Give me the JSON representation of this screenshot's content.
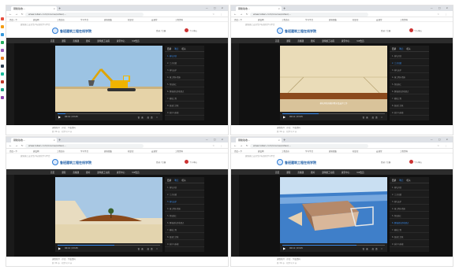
{
  "browser": {
    "tab_title": "钢筋验收…",
    "tab_close": "×",
    "new_tab": "+",
    "window_controls": "— □ ×",
    "nav_buttons": "← → ↻ ⌂",
    "url": "www.luban.com/course/video/…",
    "extensions": "☆ ⋮",
    "bookmarks": [
      "百度一下",
      "建设网",
      "工程造价",
      "学习平台",
      "建筑图集",
      "知识库",
      "云课堂",
      "工程资料"
    ]
  },
  "site": {
    "notice": "建筑施工安全生产标准化学习平台",
    "name": "鲁班建筑工程在线学院",
    "login": "登录 / 注册",
    "user": "个人中心",
    "nav": [
      "首页",
      "课程",
      "直播课",
      "题库",
      "建筑施工动画",
      "资讯中心",
      "VIP会员"
    ]
  },
  "video": {
    "play": "▶",
    "time": "00:12 / 03:45",
    "controls": "倍速 高清 ⛶",
    "caption": "基坑开挖前做好降水及支护工作"
  },
  "playlist": {
    "tabs": [
      "目录",
      "笔记",
      "相关"
    ],
    "items": [
      "1. 基坑开挖",
      "2. 土方回填",
      "3. 基坑支护",
      "4. 施工降水措施",
      "5. 垫层施工",
      "6. 钢筋绑扎验收要点",
      "7. 模板工程",
      "8. 混凝土浇筑",
      "9. 养护与拆模"
    ]
  },
  "footer": {
    "line1": "课程简介 · 评论 · 下载资料",
    "line2": "共 36 节 · 已学习 2 节"
  },
  "app_colors": [
    "#e74c3c",
    "#f39c12",
    "#3498db",
    "#27ae60",
    "#9b59b6",
    "#e67e22",
    "#2c3e50",
    "#1abc9c",
    "#c0392b",
    "#16a085",
    "#8e44ad"
  ],
  "progress": [
    0.08,
    0.35,
    0.55,
    0.72
  ],
  "active_item": [
    0,
    1,
    2,
    5
  ],
  "scenes": [
    "excavator",
    "trench",
    "mound",
    "foundation"
  ]
}
